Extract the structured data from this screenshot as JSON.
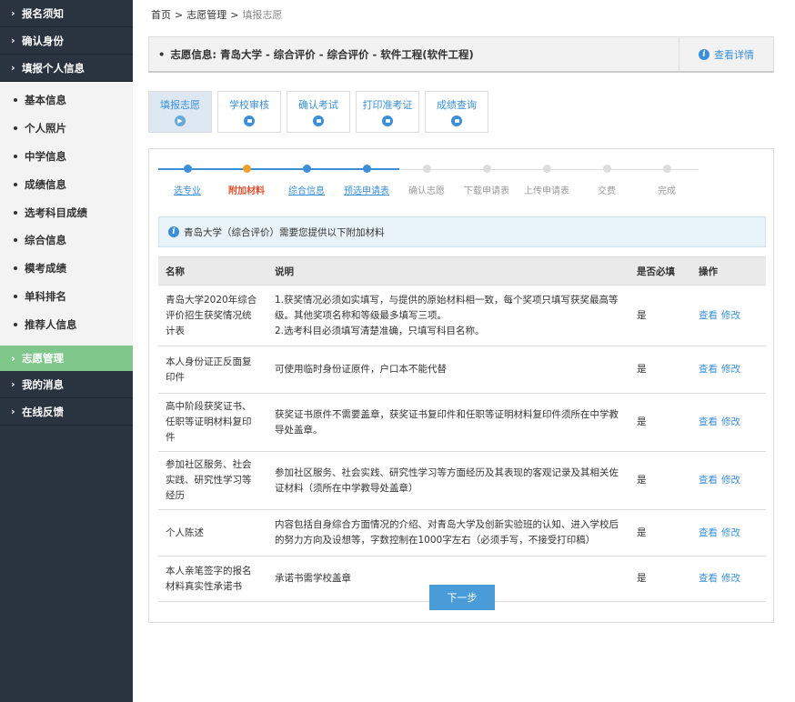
{
  "sidebar": {
    "top_items": [
      {
        "label": "报名须知"
      },
      {
        "label": "确认身份"
      },
      {
        "label": "填报个人信息"
      }
    ],
    "sub_items": [
      {
        "label": "基本信息"
      },
      {
        "label": "个人照片"
      },
      {
        "label": "中学信息"
      },
      {
        "label": "成绩信息"
      },
      {
        "label": "选考科目成绩"
      },
      {
        "label": "综合信息"
      },
      {
        "label": "模考成绩"
      },
      {
        "label": "单科排名"
      },
      {
        "label": "推荐人信息"
      }
    ],
    "active_item": {
      "label": "志愿管理"
    },
    "bottom_items": [
      {
        "label": "我的消息"
      },
      {
        "label": "在线反馈"
      }
    ]
  },
  "breadcrumb": {
    "home": "首页",
    "parent": "志愿管理",
    "current": "填报志愿",
    "sep": ">"
  },
  "infobar": {
    "label": "志愿信息:  青岛大学 - 综合评价 - 综合评价 - 软件工程(软件工程)",
    "detail": "查看详情"
  },
  "tabs": [
    {
      "label": "填报志愿",
      "active": true
    },
    {
      "label": "学校审核",
      "active": false
    },
    {
      "label": "确认考试",
      "active": false
    },
    {
      "label": "打印准考证",
      "active": false
    },
    {
      "label": "成绩查询",
      "active": false
    }
  ],
  "steps": [
    {
      "label": "选专业",
      "state": "done"
    },
    {
      "label": "附加材料",
      "state": "current"
    },
    {
      "label": "综合信息",
      "state": "done"
    },
    {
      "label": "预选申请表",
      "state": "done"
    },
    {
      "label": "确认志愿",
      "state": "todo"
    },
    {
      "label": "下载申请表",
      "state": "todo"
    },
    {
      "label": "上传申请表",
      "state": "todo"
    },
    {
      "label": "交费",
      "state": "todo"
    },
    {
      "label": "完成",
      "state": "todo"
    }
  ],
  "notice": "青岛大学（综合评价）需要您提供以下附加材料",
  "table": {
    "headers": {
      "name": "名称",
      "desc": "说明",
      "required": "是否必填",
      "ops": "操作"
    },
    "rows": [
      {
        "name": "青岛大学2020年综合评价招生获奖情况统计表",
        "desc": "1.获奖情况必须如实填写，与提供的原始材料相一致，每个奖项只填写获奖最高等级。其他奖项名称和等级最多填写三项。\n2.选考科目必须填写清楚准确，只填写科目名称。",
        "required": "是",
        "view": "查看",
        "edit": "修改"
      },
      {
        "name": "本人身份证正反面复印件",
        "desc": "可使用临时身份证原件，户口本不能代替",
        "required": "是",
        "view": "查看",
        "edit": "修改"
      },
      {
        "name": "高中阶段获奖证书、任职等证明材料复印件",
        "desc": "获奖证书原件不需要盖章，获奖证书复印件和任职等证明材料复印件须所在中学教导处盖章。",
        "required": "是",
        "view": "查看",
        "edit": "修改"
      },
      {
        "name": "参加社区服务、社会实践、研究性学习等经历",
        "desc": "参加社区服务、社会实践、研究性学习等方面经历及其表现的客观记录及其相关佐证材料（须所在中学教导处盖章）",
        "required": "是",
        "view": "查看",
        "edit": "修改"
      },
      {
        "name": "个人陈述",
        "desc": "内容包括自身综合方面情况的介绍、对青岛大学及创新实验班的认知、进入学校后的努力方向及设想等，字数控制在1000字左右（必须手写，不接受打印稿）",
        "required": "是",
        "view": "查看",
        "edit": "修改"
      },
      {
        "name": "本人亲笔签字的报名材料真实性承诺书",
        "desc": "承诺书需学校盖章",
        "required": "是",
        "view": "查看",
        "edit": "修改"
      }
    ]
  },
  "next_button": "下一步",
  "colors": {
    "accent": "#3a8fd8",
    "sidebar": "#2a3440",
    "active_nav": "#7fc78a",
    "current_step": "#f0a030"
  }
}
